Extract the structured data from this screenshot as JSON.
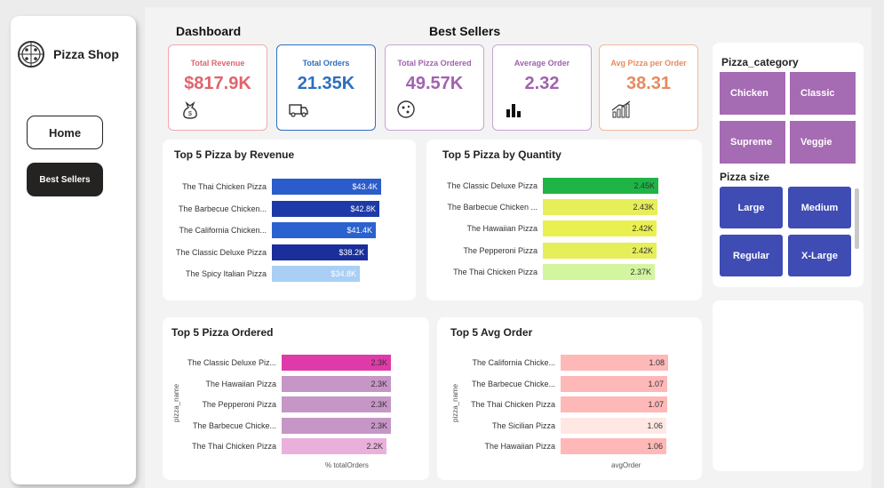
{
  "app": {
    "title": "Pizza Shop"
  },
  "nav": {
    "home": "Home",
    "best_sellers": "Best Sellers"
  },
  "headers": {
    "dashboard": "Dashboard",
    "best_sellers": "Best Sellers"
  },
  "kpis": [
    {
      "label": "Total Revenue",
      "value": "$817.9K",
      "color": "#e0646c",
      "icon": "money-bag-icon"
    },
    {
      "label": "Total Orders",
      "value": "21.35K",
      "color": "#2d6fc0",
      "icon": "delivery-truck-icon"
    },
    {
      "label": "Total Pizza Ordered",
      "value": "49.57K",
      "color": "#a262b0",
      "icon": "pizza-icon"
    },
    {
      "label": "Average Order",
      "value": "2.32",
      "color": "#a262b0",
      "icon": "bar-chart-icon"
    },
    {
      "label": "Avg Pizza per Order",
      "value": "38.31",
      "color": "#e88a60",
      "icon": "growth-chart-icon"
    }
  ],
  "slicers": {
    "category": {
      "title": "Pizza_category",
      "options": [
        "Chicken",
        "Classic",
        "Supreme",
        "Veggie"
      ]
    },
    "size": {
      "title": "Pizza size",
      "options": [
        "Large",
        "Medium",
        "Regular",
        "X-Large"
      ]
    }
  },
  "chart_data": [
    {
      "type": "bar",
      "orientation": "horizontal",
      "title": "Top 5 Pizza by Revenue",
      "categories": [
        "The Thai Chicken Pizza",
        "The Barbecue Chicken...",
        "The California Chicken...",
        "The Classic Deluxe Pizza",
        "The Spicy Italian Pizza"
      ],
      "values": [
        43.4,
        42.8,
        41.4,
        38.2,
        34.8
      ],
      "labels": [
        "$43.4K",
        "$42.8K",
        "$41.4K",
        "$38.2K",
        "$34.8K"
      ],
      "colors": [
        "#2a5ccb",
        "#1d3aa8",
        "#2a62cf",
        "#1a2f9c",
        "#a9cff5"
      ],
      "label_colors": [
        "#ffffff",
        "#ffffff",
        "#ffffff",
        "#ffffff",
        "#ffffff"
      ],
      "xlim": [
        0,
        43.4
      ]
    },
    {
      "type": "bar",
      "orientation": "horizontal",
      "title": "Top 5 Pizza by Quantity",
      "categories": [
        "The Classic Deluxe Pizza",
        "The Barbecue Chicken ...",
        "The Hawaiian Pizza",
        "The Pepperoni Pizza",
        "The Thai Chicken Pizza"
      ],
      "values": [
        2.45,
        2.43,
        2.42,
        2.42,
        2.37
      ],
      "labels": [
        "2.45K",
        "2.43K",
        "2.42K",
        "2.42K",
        "2.37K"
      ],
      "colors": [
        "#1fb446",
        "#e6ee5a",
        "#eaf050",
        "#e6ee5a",
        "#d4f5a0"
      ],
      "label_colors": [
        "#333333",
        "#333333",
        "#333333",
        "#333333",
        "#333333"
      ],
      "xlim": [
        0,
        2.45
      ]
    },
    {
      "type": "bar",
      "orientation": "horizontal",
      "title": "Top 5 Pizza Ordered",
      "categories": [
        "The Classic Deluxe Piz...",
        "The Hawaiian Pizza",
        "The Pepperoni Pizza",
        "The Barbecue Chicke...",
        "The Thai Chicken Pizza"
      ],
      "values": [
        2.3,
        2.3,
        2.3,
        2.3,
        2.2
      ],
      "labels": [
        "2.3K",
        "2.3K",
        "2.3K",
        "2.3K",
        "2.2K"
      ],
      "colors": [
        "#e03aaa",
        "#c696c6",
        "#c696c6",
        "#c696c6",
        "#eab0dc"
      ],
      "label_colors": [
        "#333333",
        "#333333",
        "#333333",
        "#333333",
        "#333333"
      ],
      "xlabel": "% totalOrders",
      "ylabel": "pizza_name",
      "xlim": [
        0,
        2.3
      ]
    },
    {
      "type": "bar",
      "orientation": "horizontal",
      "title": "Top 5 Avg Order",
      "categories": [
        "The California Chicke...",
        "The Barbecue Chicke...",
        "The Thai Chicken Pizza",
        "The Sicilian Pizza",
        "The Hawaiian Pizza"
      ],
      "values": [
        1.08,
        1.07,
        1.07,
        1.06,
        1.06
      ],
      "labels": [
        "1.08",
        "1.07",
        "1.07",
        "1.06",
        "1.06"
      ],
      "colors": [
        "#ffb8b8",
        "#ffb8b8",
        "#ffb8b8",
        "#ffe8e4",
        "#ffb8b8"
      ],
      "label_colors": [
        "#333333",
        "#333333",
        "#333333",
        "#333333",
        "#333333"
      ],
      "xlabel": "avgOrder",
      "ylabel": "pizza_name",
      "xlim": [
        0,
        1.08
      ]
    }
  ]
}
